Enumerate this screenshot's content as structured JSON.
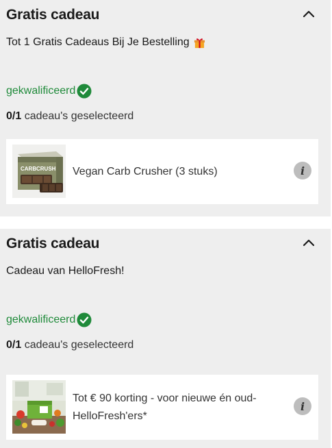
{
  "panels": [
    {
      "title": "Gratis cadeau",
      "subtitle": "Tot 1 Gratis Cadeaus Bij Je Bestelling",
      "qualified_label": "gekwalificeerd",
      "count_selected": "0/1",
      "count_suffix": "cadeau's geselecteerd",
      "product": {
        "name": "Vegan Carb Crusher (3 stuks)",
        "info_symbol": "i",
        "image_icon": "carb-crusher-box-image"
      }
    },
    {
      "title": "Gratis cadeau",
      "subtitle": "Cadeau van HelloFresh!",
      "qualified_label": "gekwalificeerd",
      "count_selected": "0/1",
      "count_suffix": "cadeau's geselecteerd",
      "product": {
        "name": "Tot € 90 korting - voor nieuwe én oud-HelloFresh'ers*",
        "info_symbol": "i",
        "image_icon": "hellofresh-box-image"
      }
    }
  ],
  "colors": {
    "panel_bg": "#eeeeee",
    "qualified_green": "#1f8a3a",
    "info_bg": "#bdbdbd"
  },
  "icons": {
    "collapse": "chevron-up-icon",
    "gift": "gift-icon",
    "qualified": "check-circle-icon",
    "info": "info-icon"
  }
}
